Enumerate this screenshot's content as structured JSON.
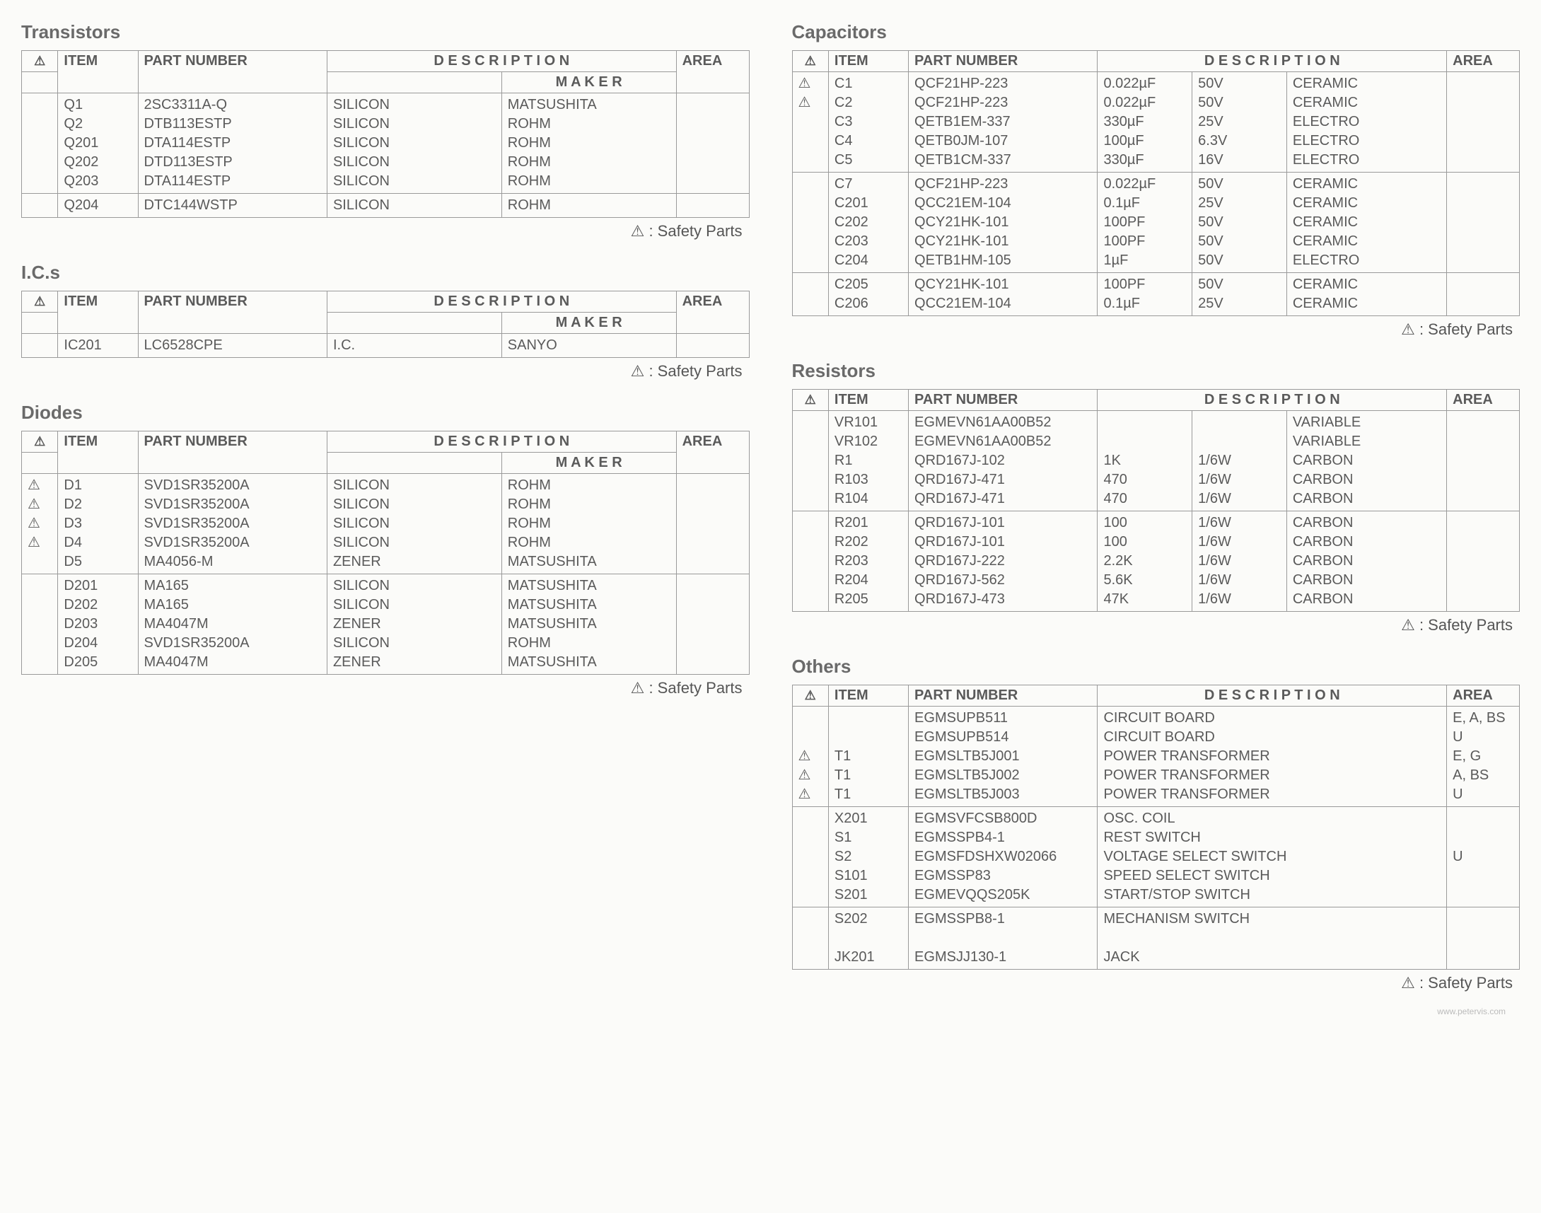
{
  "labels": {
    "warn": "⚠",
    "item": "ITEM",
    "part": "PART NUMBER",
    "desc": "D E S C R I P T I O N",
    "maker": "M A K E R",
    "area": "AREA",
    "safety": "⚠ : Safety Parts"
  },
  "sections": {
    "transistors": {
      "title": "Transistors",
      "has_maker": true,
      "groups": [
        [
          {
            "w": "",
            "item": "Q1",
            "part": "2SC3311A-Q",
            "d1": "SILICON",
            "d2": "",
            "maker": "MATSUSHITA",
            "area": ""
          },
          {
            "w": "",
            "item": "Q2",
            "part": "DTB113ESTP",
            "d1": "SILICON",
            "d2": "",
            "maker": "ROHM",
            "area": ""
          },
          {
            "w": "",
            "item": "Q201",
            "part": "DTA114ESTP",
            "d1": "SILICON",
            "d2": "",
            "maker": "ROHM",
            "area": ""
          },
          {
            "w": "",
            "item": "Q202",
            "part": "DTD113ESTP",
            "d1": "SILICON",
            "d2": "",
            "maker": "ROHM",
            "area": ""
          },
          {
            "w": "",
            "item": "Q203",
            "part": "DTA114ESTP",
            "d1": "SILICON",
            "d2": "",
            "maker": "ROHM",
            "area": ""
          }
        ],
        [
          {
            "w": "",
            "item": "Q204",
            "part": "DTC144WSTP",
            "d1": "SILICON",
            "d2": "",
            "maker": "ROHM",
            "area": ""
          }
        ]
      ]
    },
    "ics": {
      "title": "I.C.s",
      "has_maker": true,
      "groups": [
        [
          {
            "w": "",
            "item": "IC201",
            "part": "LC6528CPE",
            "d1": "I.C.",
            "d2": "",
            "maker": "SANYO",
            "area": ""
          }
        ]
      ]
    },
    "diodes": {
      "title": "Diodes",
      "has_maker": true,
      "groups": [
        [
          {
            "w": "⚠",
            "item": "D1",
            "part": "SVD1SR35200A",
            "d1": "SILICON",
            "d2": "",
            "maker": "ROHM",
            "area": ""
          },
          {
            "w": "⚠",
            "item": "D2",
            "part": "SVD1SR35200A",
            "d1": "SILICON",
            "d2": "",
            "maker": "ROHM",
            "area": ""
          },
          {
            "w": "⚠",
            "item": "D3",
            "part": "SVD1SR35200A",
            "d1": "SILICON",
            "d2": "",
            "maker": "ROHM",
            "area": ""
          },
          {
            "w": "⚠",
            "item": "D4",
            "part": "SVD1SR35200A",
            "d1": "SILICON",
            "d2": "",
            "maker": "ROHM",
            "area": ""
          },
          {
            "w": "",
            "item": "D5",
            "part": "MA4056-M",
            "d1": "ZENER",
            "d2": "",
            "maker": "MATSUSHITA",
            "area": ""
          }
        ],
        [
          {
            "w": "",
            "item": "D201",
            "part": "MA165",
            "d1": "SILICON",
            "d2": "",
            "maker": "MATSUSHITA",
            "area": ""
          },
          {
            "w": "",
            "item": "D202",
            "part": "MA165",
            "d1": "SILICON",
            "d2": "",
            "maker": "MATSUSHITA",
            "area": ""
          },
          {
            "w": "",
            "item": "D203",
            "part": "MA4047M",
            "d1": "ZENER",
            "d2": "",
            "maker": "MATSUSHITA",
            "area": ""
          },
          {
            "w": "",
            "item": "D204",
            "part": "SVD1SR35200A",
            "d1": "SILICON",
            "d2": "",
            "maker": "ROHM",
            "area": ""
          },
          {
            "w": "",
            "item": "D205",
            "part": "MA4047M",
            "d1": "ZENER",
            "d2": "",
            "maker": "MATSUSHITA",
            "area": ""
          }
        ]
      ]
    },
    "capacitors": {
      "title": "Capacitors",
      "has_maker": false,
      "groups": [
        [
          {
            "w": "⚠",
            "item": "C1",
            "part": "QCF21HP-223",
            "d1": "0.022µF",
            "d2": "50V",
            "d3": "CERAMIC",
            "area": ""
          },
          {
            "w": "⚠",
            "item": "C2",
            "part": "QCF21HP-223",
            "d1": "0.022µF",
            "d2": "50V",
            "d3": "CERAMIC",
            "area": ""
          },
          {
            "w": "",
            "item": "C3",
            "part": "QETB1EM-337",
            "d1": "330µF",
            "d2": "25V",
            "d3": "ELECTRO",
            "area": ""
          },
          {
            "w": "",
            "item": "C4",
            "part": "QETB0JM-107",
            "d1": "100µF",
            "d2": "6.3V",
            "d3": "ELECTRO",
            "area": ""
          },
          {
            "w": "",
            "item": "C5",
            "part": "QETB1CM-337",
            "d1": "330µF",
            "d2": "16V",
            "d3": "ELECTRO",
            "area": ""
          }
        ],
        [
          {
            "w": "",
            "item": "C7",
            "part": "QCF21HP-223",
            "d1": "0.022µF",
            "d2": "50V",
            "d3": "CERAMIC",
            "area": ""
          },
          {
            "w": "",
            "item": "C201",
            "part": "QCC21EM-104",
            "d1": "0.1µF",
            "d2": "25V",
            "d3": "CERAMIC",
            "area": ""
          },
          {
            "w": "",
            "item": "C202",
            "part": "QCY21HK-101",
            "d1": "100PF",
            "d2": "50V",
            "d3": "CERAMIC",
            "area": ""
          },
          {
            "w": "",
            "item": "C203",
            "part": "QCY21HK-101",
            "d1": "100PF",
            "d2": "50V",
            "d3": "CERAMIC",
            "area": ""
          },
          {
            "w": "",
            "item": "C204",
            "part": "QETB1HM-105",
            "d1": "1µF",
            "d2": "50V",
            "d3": "ELECTRO",
            "area": ""
          }
        ],
        [
          {
            "w": "",
            "item": "C205",
            "part": "QCY21HK-101",
            "d1": "100PF",
            "d2": "50V",
            "d3": "CERAMIC",
            "area": ""
          },
          {
            "w": "",
            "item": "C206",
            "part": "QCC21EM-104",
            "d1": "0.1µF",
            "d2": "25V",
            "d3": "CERAMIC",
            "area": ""
          }
        ]
      ]
    },
    "resistors": {
      "title": "Resistors",
      "has_maker": false,
      "groups": [
        [
          {
            "w": "",
            "item": "VR101",
            "part": "EGMEVN61AA00B52",
            "d1": "",
            "d2": "",
            "d3": "VARIABLE",
            "area": ""
          },
          {
            "w": "",
            "item": "VR102",
            "part": "EGMEVN61AA00B52",
            "d1": "",
            "d2": "",
            "d3": "VARIABLE",
            "area": ""
          },
          {
            "w": "",
            "item": "R1",
            "part": "QRD167J-102",
            "d1": "1K",
            "d2": "1/6W",
            "d3": "CARBON",
            "area": ""
          },
          {
            "w": "",
            "item": "R103",
            "part": "QRD167J-471",
            "d1": "470",
            "d2": "1/6W",
            "d3": "CARBON",
            "area": ""
          },
          {
            "w": "",
            "item": "R104",
            "part": "QRD167J-471",
            "d1": "470",
            "d2": "1/6W",
            "d3": "CARBON",
            "area": ""
          }
        ],
        [
          {
            "w": "",
            "item": "R201",
            "part": "QRD167J-101",
            "d1": "100",
            "d2": "1/6W",
            "d3": "CARBON",
            "area": ""
          },
          {
            "w": "",
            "item": "R202",
            "part": "QRD167J-101",
            "d1": "100",
            "d2": "1/6W",
            "d3": "CARBON",
            "area": ""
          },
          {
            "w": "",
            "item": "R203",
            "part": "QRD167J-222",
            "d1": "2.2K",
            "d2": "1/6W",
            "d3": "CARBON",
            "area": ""
          },
          {
            "w": "",
            "item": "R204",
            "part": "QRD167J-562",
            "d1": "5.6K",
            "d2": "1/6W",
            "d3": "CARBON",
            "area": ""
          },
          {
            "w": "",
            "item": "R205",
            "part": "QRD167J-473",
            "d1": "47K",
            "d2": "1/6W",
            "d3": "CARBON",
            "area": ""
          }
        ]
      ]
    },
    "others": {
      "title": "Others",
      "groups": [
        [
          {
            "w": "",
            "item": "",
            "part": "EGMSUPB511",
            "desc": "CIRCUIT BOARD",
            "area": "E, A, BS"
          },
          {
            "w": "",
            "item": "",
            "part": "EGMSUPB514",
            "desc": "CIRCUIT BOARD",
            "area": "U"
          },
          {
            "w": "⚠",
            "item": "T1",
            "part": "EGMSLTB5J001",
            "desc": "POWER TRANSFORMER",
            "area": "E, G"
          },
          {
            "w": "⚠",
            "item": "T1",
            "part": "EGMSLTB5J002",
            "desc": "POWER TRANSFORMER",
            "area": "A, BS"
          },
          {
            "w": "⚠",
            "item": "T1",
            "part": "EGMSLTB5J003",
            "desc": "POWER TRANSFORMER",
            "area": "U"
          }
        ],
        [
          {
            "w": "",
            "item": "X201",
            "part": "EGMSVFCSB800D",
            "desc": "OSC. COIL",
            "area": ""
          },
          {
            "w": "",
            "item": "S1",
            "part": "EGMSSPB4-1",
            "desc": "REST SWITCH",
            "area": ""
          },
          {
            "w": "",
            "item": "S2",
            "part": "EGMSFDSHXW02066",
            "desc": "VOLTAGE SELECT SWITCH",
            "area": "U"
          },
          {
            "w": "",
            "item": "S101",
            "part": "EGMSSP83",
            "desc": "SPEED SELECT SWITCH",
            "area": ""
          },
          {
            "w": "",
            "item": "S201",
            "part": "EGMEVQQS205K",
            "desc": "START/STOP SWITCH",
            "area": ""
          }
        ],
        [
          {
            "w": "",
            "item": "S202",
            "part": "EGMSSPB8-1",
            "desc": "MECHANISM SWITCH",
            "area": ""
          },
          {
            "w": "",
            "item": "",
            "part": "",
            "desc": "",
            "area": ""
          },
          {
            "w": "",
            "item": "JK201",
            "part": "EGMSJJ130-1",
            "desc": "JACK",
            "area": ""
          }
        ]
      ]
    }
  },
  "watermark": "www.petervis.com"
}
